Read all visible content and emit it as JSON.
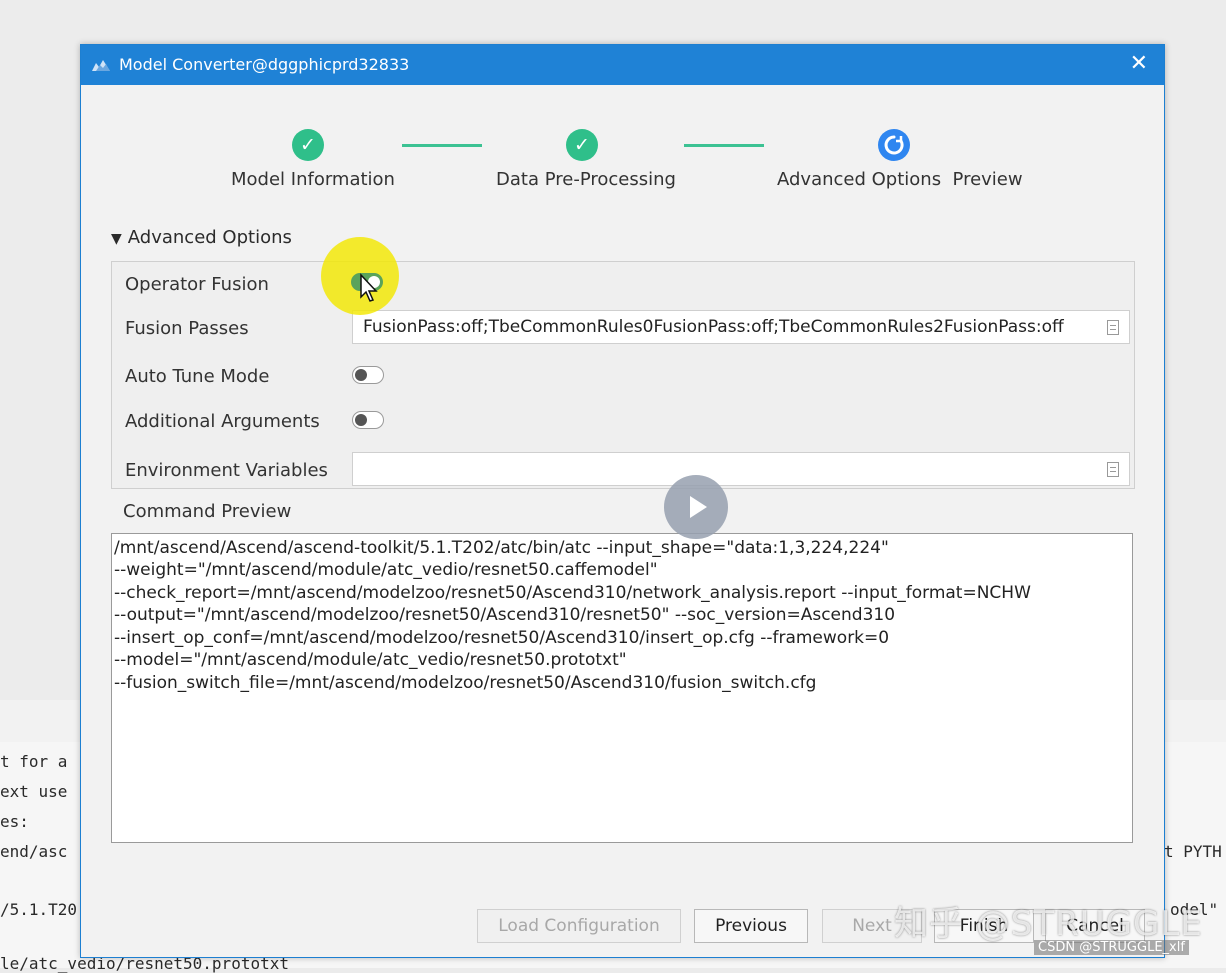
{
  "window": {
    "title": "Model Converter@dggphicprd32833",
    "close_symbol": "✕"
  },
  "steps": [
    {
      "label": "Model Information",
      "status": "done",
      "icon": "check-icon"
    },
    {
      "label": "Data Pre-Processing",
      "status": "done",
      "icon": "check-icon"
    },
    {
      "label": "Advanced Options  Preview",
      "status": "current",
      "icon": "spinner-icon"
    }
  ],
  "advanced": {
    "section_title": "Advanced Options",
    "operator_fusion": {
      "label": "Operator Fusion",
      "on": true
    },
    "fusion_passes": {
      "label": "Fusion Passes",
      "value": "FusionPass:off;TbeCommonRules0FusionPass:off;TbeCommonRules2FusionPass:off"
    },
    "auto_tune": {
      "label": "Auto Tune Mode",
      "on": false
    },
    "additional_args": {
      "label": "Additional Arguments",
      "on": false
    },
    "env_vars": {
      "label": "Environment Variables",
      "value": ""
    }
  },
  "command_preview": {
    "label": "Command Preview",
    "lines": [
      "/mnt/ascend/Ascend/ascend-toolkit/5.1.T202/atc/bin/atc  --input_shape=\"data:1,3,224,224\"",
      "--weight=\"/mnt/ascend/module/atc_vedio/resnet50.caffemodel\"",
      "--check_report=/mnt/ascend/modelzoo/resnet50/Ascend310/network_analysis.report --input_format=NCHW",
      "--output=\"/mnt/ascend/modelzoo/resnet50/Ascend310/resnet50\" --soc_version=Ascend310",
      "--insert_op_conf=/mnt/ascend/modelzoo/resnet50/Ascend310/insert_op.cfg --framework=0",
      "--model=\"/mnt/ascend/module/atc_vedio/resnet50.prototxt\"",
      "--fusion_switch_file=/mnt/ascend/modelzoo/resnet50/Ascend310/fusion_switch.cfg"
    ]
  },
  "buttons": {
    "load_config": "Load Configuration",
    "previous": "Previous",
    "next": "Next",
    "finish": "Finish",
    "cancel": "Cancel"
  },
  "background_terminal": [
    "t for a",
    "ext use",
    "es:",
    "end/asc",
    "/5.1.T20",
    "le/atc_vedio/resnet50.prototxt",
    "t PYTH",
    "odel\""
  ],
  "overlay": {
    "watermark": "知乎 @STRUGGLE",
    "source_tag": "CSDN @STRUGGLE_xlf"
  },
  "colors": {
    "titlebar": "#1f82d6",
    "step_done": "#2fbf8a",
    "step_current": "#2f86f0",
    "switch_on": "#5aa35b",
    "highlight": "#f3e800"
  }
}
